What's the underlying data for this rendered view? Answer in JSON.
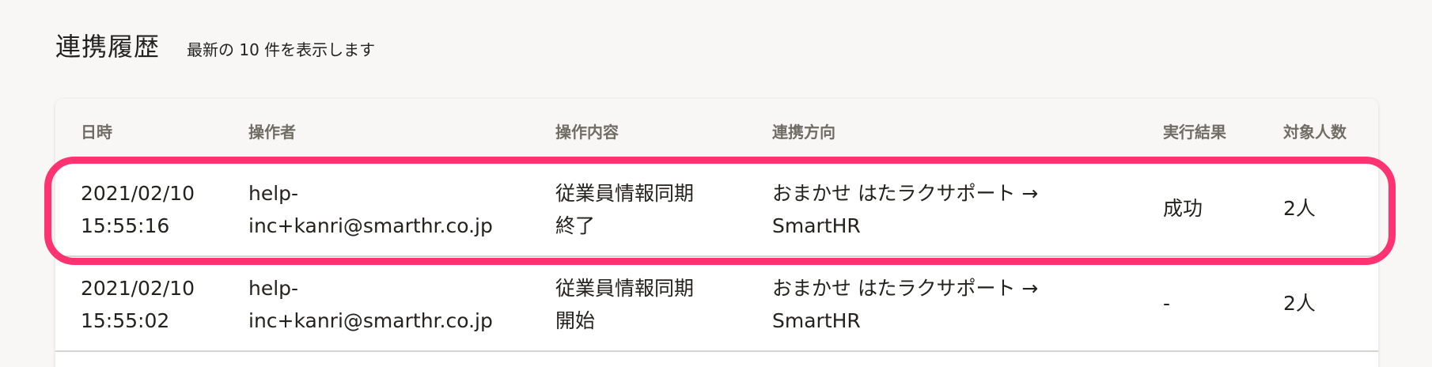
{
  "header": {
    "title": "連携履歴",
    "subtitle": "最新の 10 件を表示します"
  },
  "table": {
    "columns": [
      "日時",
      "操作者",
      "操作内容",
      "連携方向",
      "実行結果",
      "対象人数"
    ],
    "rows": [
      {
        "datetime": "2021/02/10\n15:55:16",
        "operator": "help-\ninc+kanri@smarthr.co.jp",
        "action": "従業員情報同期\n終了",
        "direction": "おまかせ はたラクサポート →\nSmartHR",
        "result": "成功",
        "count": "2人"
      },
      {
        "datetime": "2021/02/10\n15:55:02",
        "operator": "help-\ninc+kanri@smarthr.co.jp",
        "action": "従業員情報同期\n開始",
        "direction": "おまかせ はたラクサポート →\nSmartHR",
        "result": "-",
        "count": "2人"
      }
    ]
  },
  "colors": {
    "highlight": "#ff3272",
    "header_text": "#706d65",
    "background": "#f8f7f6"
  }
}
